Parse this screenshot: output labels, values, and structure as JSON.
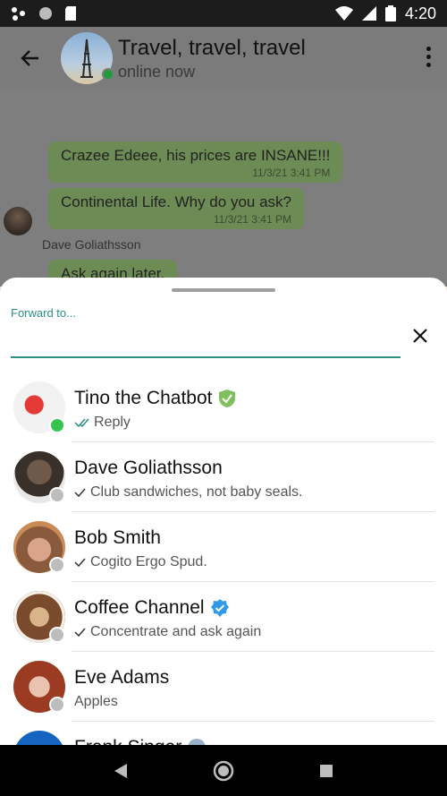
{
  "status_bar": {
    "time": "4:20"
  },
  "header": {
    "title": "Travel, travel, travel",
    "subtitle": "online now"
  },
  "messages": [
    {
      "text": "Crazee Edeee, his prices are INSANE!!!",
      "time": "11/3/21 3:41 PM"
    },
    {
      "text": "Continental Life.  Why do you ask?",
      "time": "11/3/21 3:41 PM"
    },
    {
      "text": "Ask again later."
    }
  ],
  "sender_name": "Dave Goliathsson",
  "sheet": {
    "label": "Forward to...",
    "input_value": ""
  },
  "contacts": [
    {
      "name": "Tino the Chatbot",
      "preview": "Reply",
      "online": true,
      "badge": "verified-shield-green",
      "check": "double"
    },
    {
      "name": "Dave Goliathsson",
      "preview": "Club sandwiches, not baby seals.",
      "online": false,
      "check": "single"
    },
    {
      "name": "Bob Smith",
      "preview": "Cogito Ergo Spud.",
      "online": false,
      "check": "single"
    },
    {
      "name": "Coffee Channel",
      "preview": "Concentrate and ask again",
      "online": false,
      "badge": "verified-badge-blue",
      "check": "single"
    },
    {
      "name": "Eve Adams",
      "preview": "Apples",
      "online": false,
      "check": "none"
    },
    {
      "name": "Frank Singer",
      "preview": "",
      "online": false,
      "badge": "info-badge-gray",
      "check": "none"
    }
  ],
  "colors": {
    "accent": "#2a8f84",
    "online": "#34c44f",
    "bubble": "#dcf8c6",
    "verified_blue": "#2f9ae8",
    "verified_green": "#7fbf5c"
  }
}
